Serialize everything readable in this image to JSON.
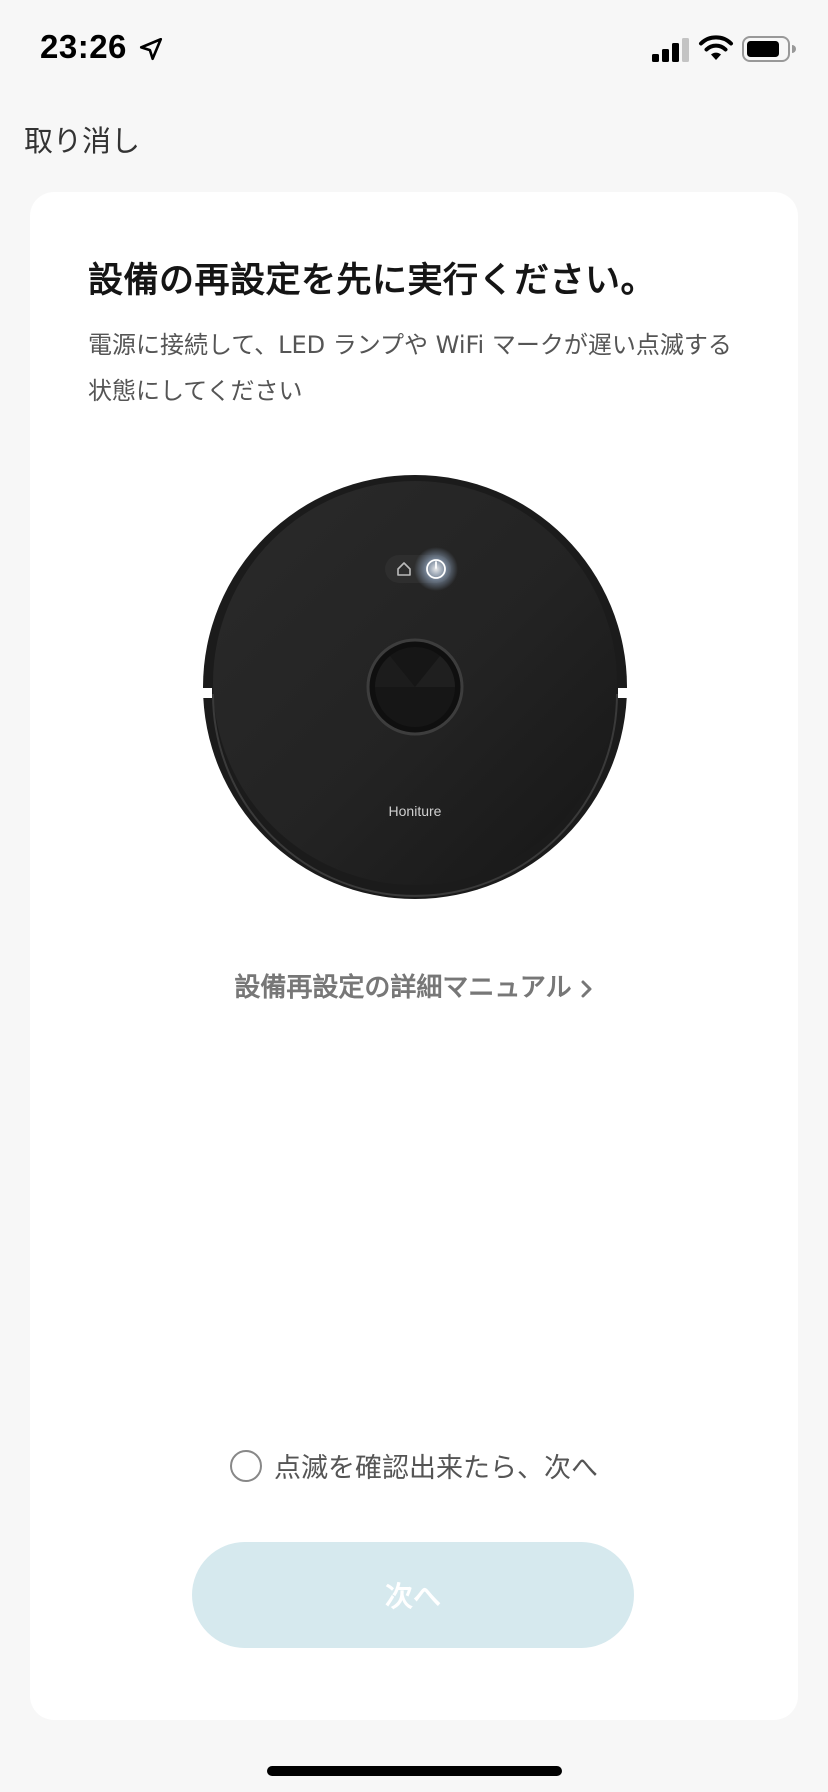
{
  "status_bar": {
    "time": "23:26"
  },
  "navigation": {
    "cancel_label": "取り消し"
  },
  "card": {
    "title": "設備の再設定を先に実行ください。",
    "description": "電源に接続して、LED ランプや WiFi マークが遅い点滅する状態にしてください",
    "robot_brand": "Honiture",
    "manual_link_label": "設備再設定の詳細マニュアル",
    "confirm_label": "点滅を確認出来たら、次へ",
    "next_button_label": "次へ"
  },
  "colors": {
    "next_button_bg": "#d6e9ee",
    "page_bg": "#f7f7f7",
    "card_bg": "#ffffff"
  },
  "icons": {
    "location": "location-arrow-icon",
    "signal": "cellular-signal-icon",
    "wifi": "wifi-icon",
    "battery": "battery-icon",
    "chevron": "chevron-right-icon",
    "home": "home-icon",
    "power": "power-icon"
  }
}
